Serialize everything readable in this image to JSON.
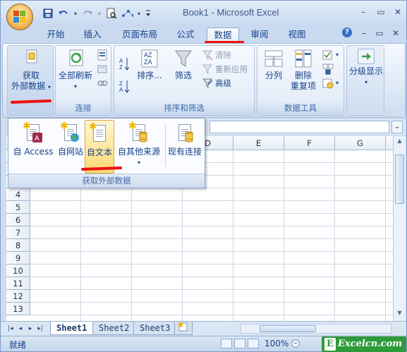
{
  "window": {
    "title": "Book1 - Microsoft Excel"
  },
  "qat": {
    "icons": [
      "save-icon",
      "undo-icon",
      "redo-icon",
      "print-preview-icon",
      "shapes-icon",
      "customize-icon"
    ]
  },
  "window_controls": {
    "minimize": "–",
    "restore": "▭",
    "close": "✕"
  },
  "tabs": [
    "开始",
    "插入",
    "页面布局",
    "公式",
    "数据",
    "审阅",
    "视图"
  ],
  "active_tab": "数据",
  "ribbon_right_icons": [
    "help-icon",
    "minimize-ribbon-icon",
    "restore-icon",
    "close-icon"
  ],
  "ribbon_right_glyphs": [
    "?",
    "–",
    "▭",
    "✕"
  ],
  "ribbon": {
    "get_external": {
      "label_line1": "获取",
      "label_line2": "外部数据",
      "arrow": "▾"
    },
    "connections": {
      "refresh_label": "全部刷新",
      "arrow": "▾",
      "group_label": "连接"
    },
    "sort_filter": {
      "sort_label": "排序...",
      "filter_label": "筛选",
      "clear_label": "清除",
      "reapply_label": "重新应用",
      "advanced_label": "高级",
      "group_label": "排序和筛选"
    },
    "data_tools": {
      "split_label": "分列",
      "remove_dup_line1": "删除",
      "remove_dup_line2": "重复项",
      "group_label": "数据工具"
    },
    "outline": {
      "label": "分级显示",
      "arrow": "▾"
    }
  },
  "dropdown": {
    "items": [
      {
        "label": "自 Access",
        "icon": "access-icon"
      },
      {
        "label": "自网站",
        "icon": "web-icon"
      },
      {
        "label": "自文本",
        "icon": "text-file-icon"
      },
      {
        "label": "自其他来源",
        "icon": "other-sources-icon",
        "arrow": "▾"
      },
      {
        "label": "现有连接",
        "icon": "existing-connections-icon"
      }
    ],
    "hovered": "自文本",
    "group_label": "获取外部数据"
  },
  "grid": {
    "columns": [
      "D",
      "E",
      "F",
      "G"
    ],
    "rows": [
      "4",
      "5",
      "6",
      "7",
      "8",
      "9",
      "10",
      "11",
      "12",
      "13"
    ]
  },
  "sheets": {
    "tabs": [
      "Sheet1",
      "Sheet2",
      "Sheet3"
    ],
    "active": "Sheet1",
    "nav": [
      "|◂",
      "◂",
      "▸",
      "▸|"
    ]
  },
  "formula_bar": {
    "expand_glyph": "⌄"
  },
  "status": {
    "text": "就绪",
    "zoom": "100%"
  },
  "watermark": {
    "text": "Excelcn.com",
    "letter": "E"
  },
  "colors": {
    "annotation_red": "#ee1010",
    "hover_yellow": "#ffd872",
    "watermark_green": "#2e9b3a"
  }
}
